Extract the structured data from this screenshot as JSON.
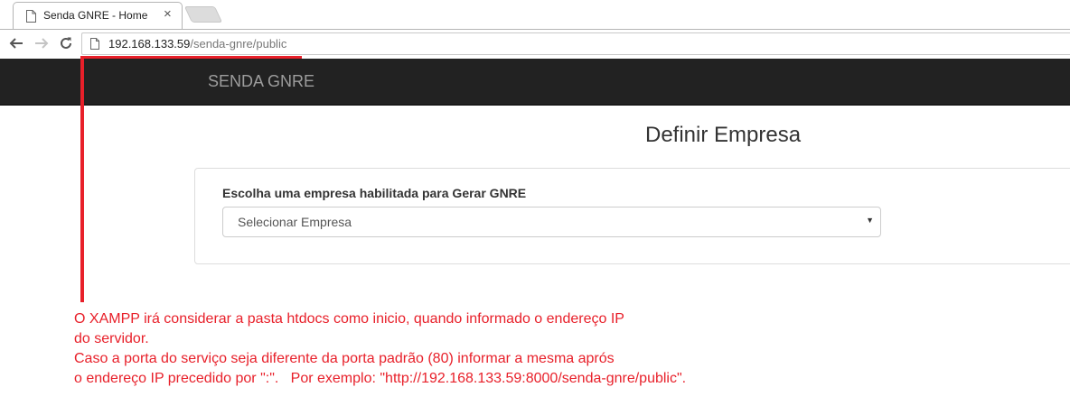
{
  "browser": {
    "tab_title": "Senda GNRE - Home",
    "tab_close": "×",
    "url_host": "192.168.133.59",
    "url_path": "/senda-gnre/public"
  },
  "navbar": {
    "brand": "SENDA GNRE"
  },
  "main": {
    "title": "Definir Empresa",
    "form": {
      "label": "Escolha uma empresa habilitada para Gerar GNRE",
      "select_value": "Selecionar Empresa",
      "select_caret": "▼"
    }
  },
  "annotation": {
    "color": "#e8202a",
    "lines": [
      "O XAMPP irá considerar a pasta htdocs como inicio, quando informado o endereço IP",
      "do servidor.",
      "Caso a porta do serviço seja diferente da porta padrão (80) informar a mesma aprós",
      "o endereço IP precedido por \":\".   Por exemplo: \"http://192.168.133.59:8000/senda-gnre/public\"."
    ]
  },
  "colors": {
    "navbar_bg": "#222222",
    "brand_text": "#9d9d9d",
    "annotation_red": "#e8202a"
  }
}
